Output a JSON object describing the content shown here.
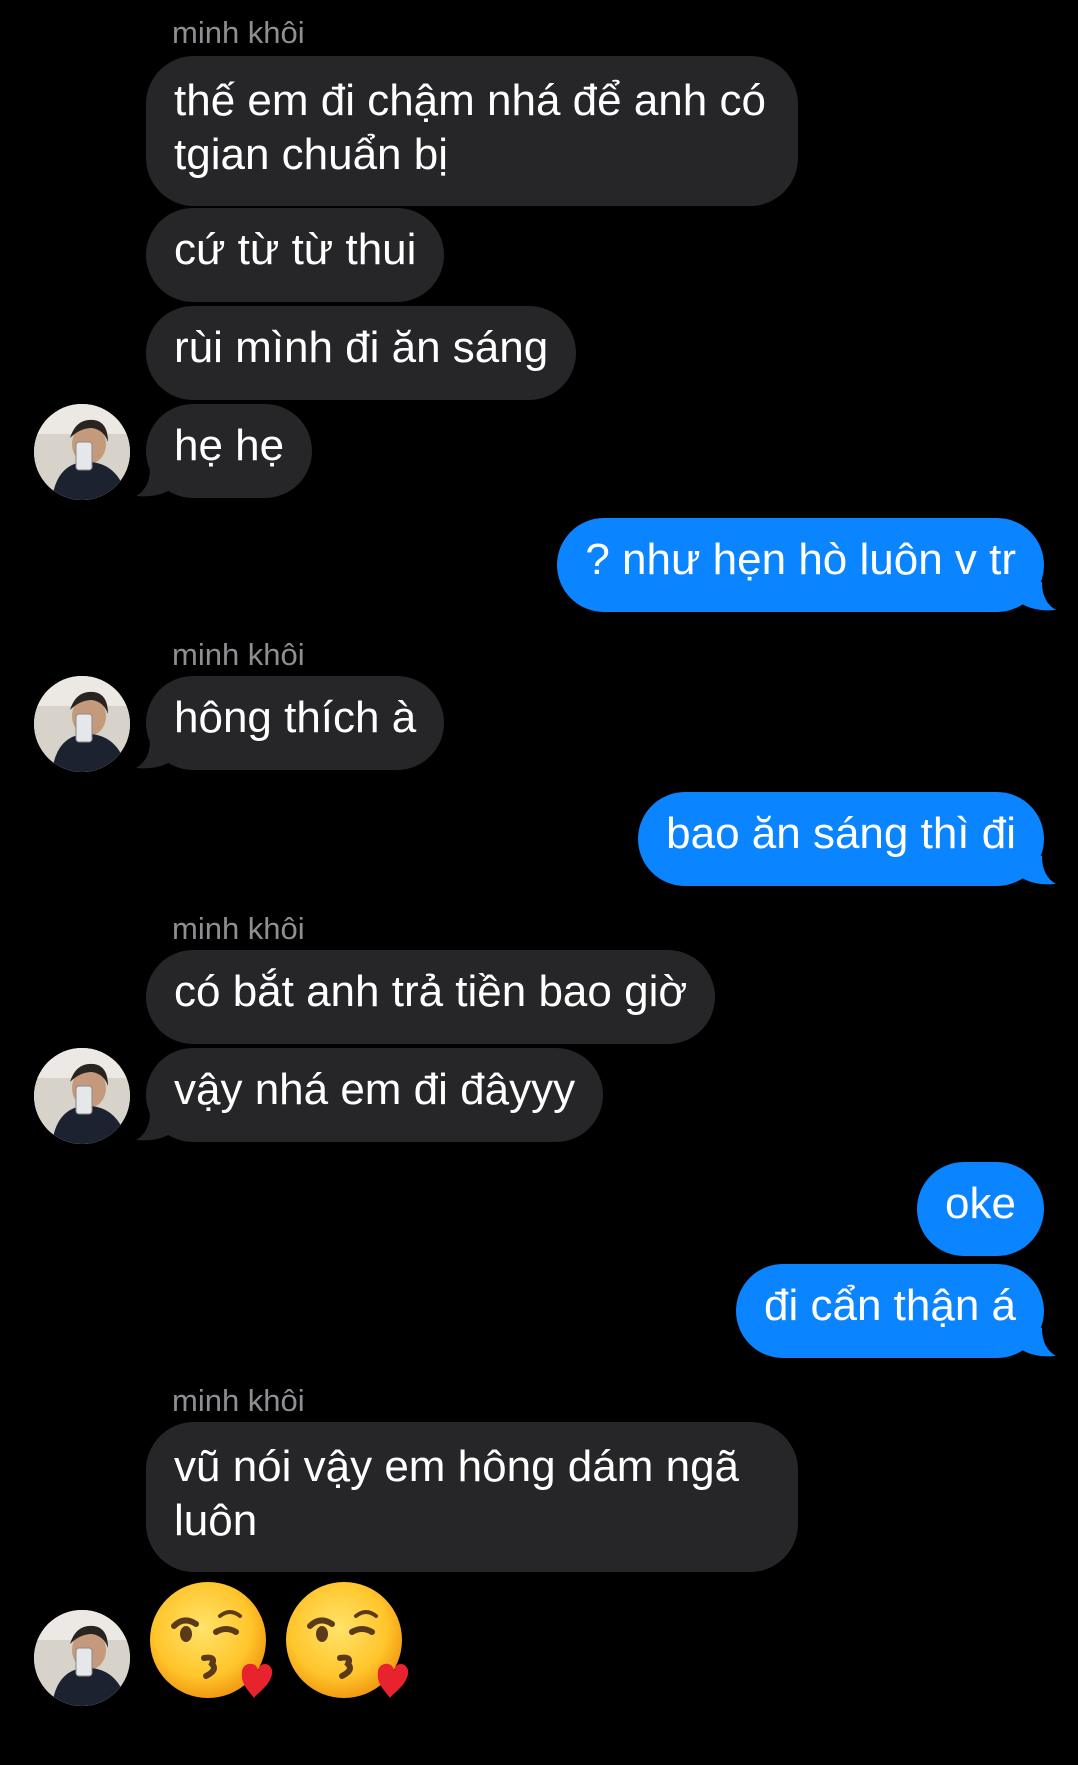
{
  "conversation": {
    "sender_labels": [
      "minh khôi",
      "minh khôi",
      "minh khôi",
      "minh khôi"
    ],
    "messages": [
      {
        "from": "them",
        "text": "thế em đi chậm nhá để anh có tgian chuẩn bị"
      },
      {
        "from": "them",
        "text": "cứ từ từ thui"
      },
      {
        "from": "them",
        "text": "rùi mình đi ăn sáng"
      },
      {
        "from": "them",
        "text": "hẹ hẹ"
      },
      {
        "from": "me",
        "text": "? như hẹn hò luôn v tr"
      },
      {
        "from": "them",
        "text": "hông thích à"
      },
      {
        "from": "me",
        "text": "bao ăn sáng thì đi"
      },
      {
        "from": "them",
        "text": "có bắt anh trả tiền bao giờ"
      },
      {
        "from": "them",
        "text": "vậy nhá em đi đâyyy"
      },
      {
        "from": "me",
        "text": "oke"
      },
      {
        "from": "me",
        "text": "đi cẩn thận á"
      },
      {
        "from": "them",
        "text": "vũ nói vậy em hông dám ngã luôn"
      }
    ],
    "emoji_message": [
      "face-blowing-a-kiss",
      "face-blowing-a-kiss"
    ]
  },
  "colors": {
    "background": "#000000",
    "incoming_bubble": "#262628",
    "outgoing_bubble": "#0a84ff",
    "sender_label": "#8e8e93"
  },
  "icons": {
    "avatar": "user-avatar-photo",
    "emoji": "kissing-face-with-heart-emoji"
  }
}
